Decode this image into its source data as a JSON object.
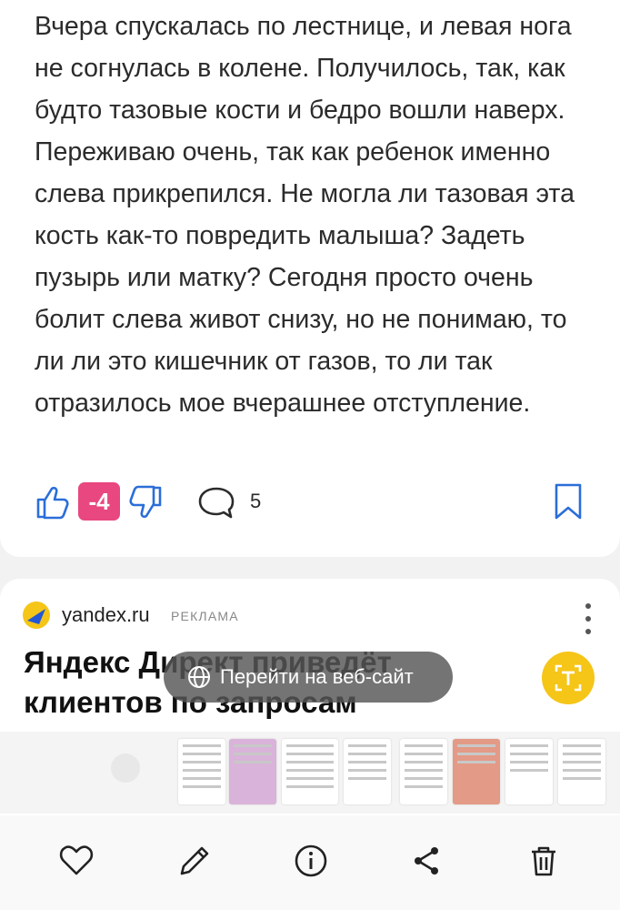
{
  "post": {
    "text": "Вчера спускалась по лестнице, и левая нога не согнулась в колене. Получилось, так, как будто тазовые кости и бедро вошли наверх. Переживаю очень, так как ребенок именно слева прикрепился. Не могла ли тазовая эта кость как-то повредить малыша? Задеть пузырь или матку? Сегодня просто очень болит слева живот снизу, но не понимаю, то ли ли это кишечник от газов, то ли так отразилось мое вчерашнее отступление.",
    "score": "-4",
    "comments_count": "5",
    "score_color": "#e8477f"
  },
  "ad": {
    "domain": "yandex.ru",
    "label": "РЕКЛАМА",
    "title": "Яндекс Директ приведёт клиентов по запросам",
    "cta": "Перейти на веб-сайт",
    "brand_color": "#f5c518"
  },
  "icons": {
    "like": "thumbs-up-icon",
    "dislike": "thumbs-down-icon",
    "comments": "comment-bubble-icon",
    "bookmark": "bookmark-icon",
    "toolbar": [
      "heart-icon",
      "edit-pencil-icon",
      "info-icon",
      "share-icon",
      "trash-icon"
    ]
  }
}
